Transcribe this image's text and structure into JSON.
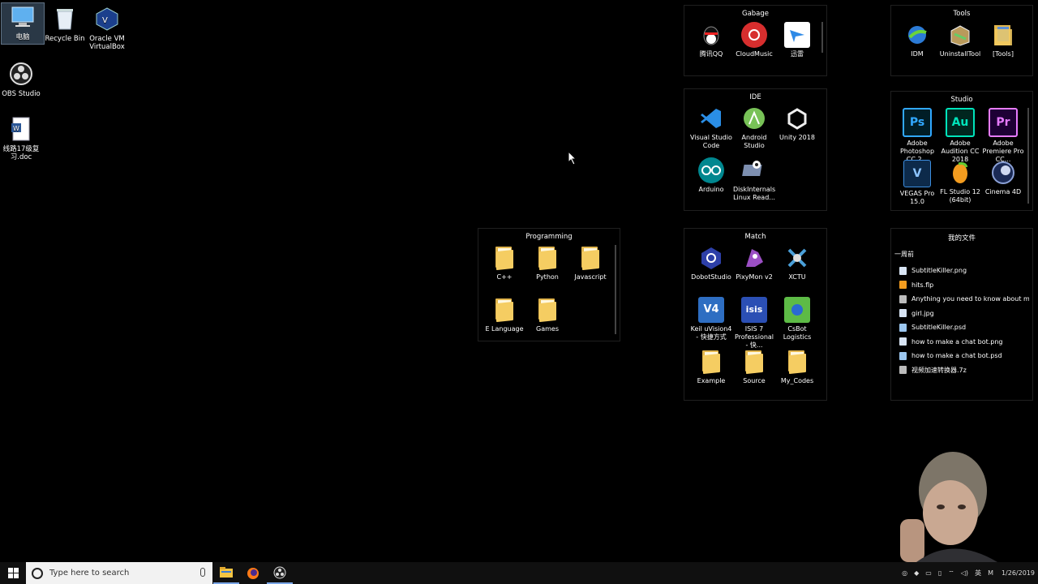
{
  "desktop_icons": [
    {
      "label": "电脑",
      "icon": "computer-icon",
      "selected": true
    },
    {
      "label": "Recycle Bin",
      "icon": "recycle-bin-icon"
    },
    {
      "label": "Oracle VM VirtualBox",
      "icon": "virtualbox-icon"
    },
    {
      "label": "OBS Studio",
      "icon": "obs-icon"
    },
    {
      "label": "线路17级复习.doc",
      "icon": "word-doc-icon"
    }
  ],
  "fences": {
    "gabage": {
      "title": "Gabage",
      "items": [
        "腾讯QQ",
        "CloudMusic",
        "迅雷"
      ]
    },
    "tools": {
      "title": "Tools",
      "items": [
        "IDM",
        "UninstallTool",
        "[Tools]"
      ]
    },
    "ide": {
      "title": "IDE",
      "items": [
        "Visual Studio Code",
        "Android Studio",
        "Unity 2018",
        "Arduino",
        "DiskInternals Linux Read..."
      ]
    },
    "studio": {
      "title": "Studio",
      "items": [
        "Adobe Photoshop CC 2...",
        "Adobe Audition CC 2018",
        "Adobe Premiere Pro CC...",
        "VEGAS Pro 15.0",
        "FL Studio 12 (64bit)",
        "Cinema 4D"
      ]
    },
    "programming": {
      "title": "Programming",
      "items": [
        "C++",
        "Python",
        "Javascript",
        "E Language",
        "Games"
      ]
    },
    "match": {
      "title": "Match",
      "items": [
        "DobotStudio",
        "PixyMon v2",
        "XCTU",
        "Keil uVision4 - 快捷方式",
        "ISIS 7 Professional - 快...",
        "CsBot Logistics",
        "Example",
        "Source",
        "My_Codes"
      ]
    },
    "myfiles": {
      "title": "我的文件",
      "group": "一周前",
      "files": [
        "SubtitleKiller.png",
        "hits.flp",
        "Anything you need to know about m...",
        "girl.jpg",
        "SubtitleKiller.psd",
        "how to make a chat bot.png",
        "how to make a chat bot.psd",
        "视频加速转换器.7z"
      ]
    }
  },
  "taskbar": {
    "search_placeholder": "Type here to search",
    "tray_lang": "英",
    "tray_ime": "M",
    "clock_date": "1/26/2019"
  }
}
